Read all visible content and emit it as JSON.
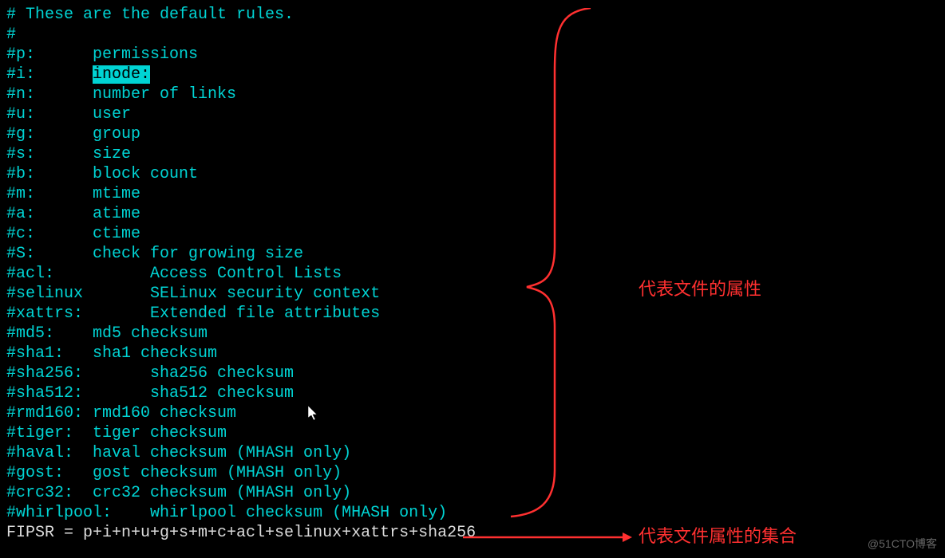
{
  "lines": {
    "l0": "# These are the default rules.",
    "l1": "#",
    "l2a": "#p:      permissions",
    "l3a": "#i:      ",
    "l3b": "inode:",
    "l4": "#n:      number of links",
    "l5": "#u:      user",
    "l6": "#g:      group",
    "l7": "#s:      size",
    "l8": "#b:      block count",
    "l9": "#m:      mtime",
    "l10": "#a:      atime",
    "l11": "#c:      ctime",
    "l12": "#S:      check for growing size",
    "l13": "#acl:          Access Control Lists",
    "l14": "#selinux       SELinux security context",
    "l15": "#xattrs:       Extended file attributes",
    "l16": "#md5:    md5 checksum",
    "l17": "#sha1:   sha1 checksum",
    "l18": "#sha256:       sha256 checksum",
    "l19": "#sha512:       sha512 checksum",
    "l20": "#rmd160: rmd160 checksum",
    "l21": "#tiger:  tiger checksum",
    "l22": "",
    "l23": "#haval:  haval checksum (MHASH only)",
    "l24": "#gost:   gost checksum (MHASH only)",
    "l25": "#crc32:  crc32 checksum (MHASH only)",
    "l26": "#whirlpool:    whirlpool checksum (MHASH only)",
    "l27": "",
    "l28": "FIPSR = p+i+n+u+g+s+m+c+acl+selinux+xattrs+sha256"
  },
  "annotations": {
    "label1": "代表文件的属性",
    "label2": "代表文件属性的集合"
  },
  "watermark": "@51CTO博客"
}
